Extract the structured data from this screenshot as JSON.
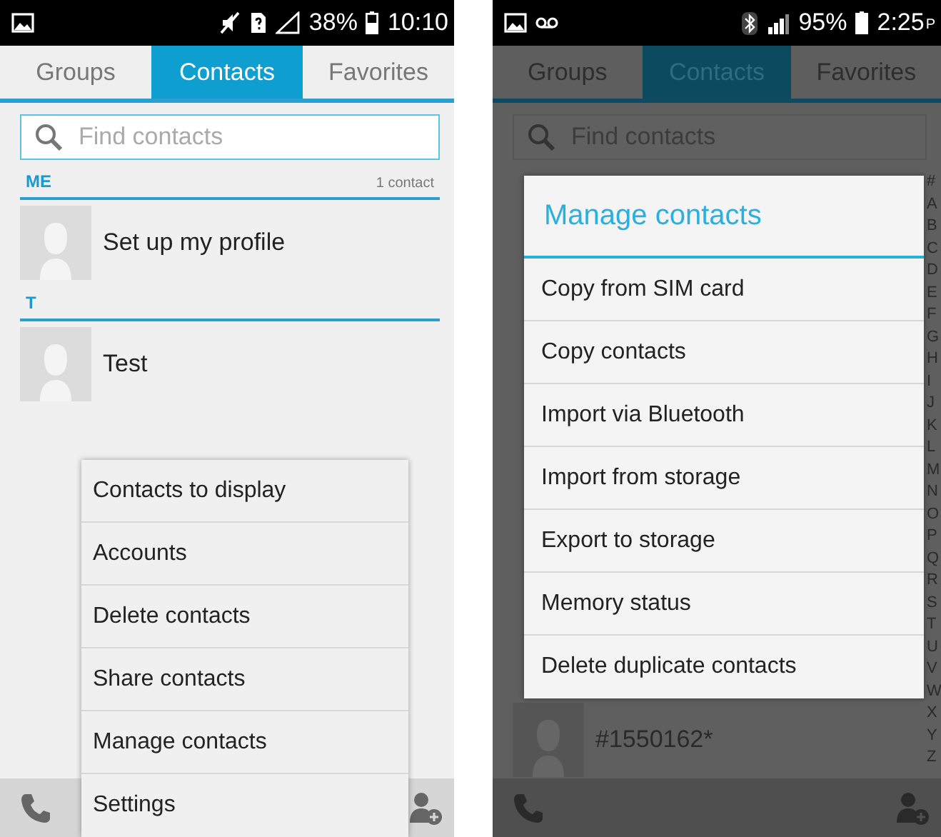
{
  "screens": [
    {
      "dimmed": false,
      "status_bar": {
        "vibrate_muted": true,
        "sim_missing": true,
        "no_signal": true,
        "battery": "38%",
        "time": "10:10"
      },
      "tabs": [
        {
          "label": "Groups",
          "selected": false
        },
        {
          "label": "Contacts",
          "selected": true
        },
        {
          "label": "Favorites",
          "selected": false
        }
      ],
      "search": {
        "placeholder": "Find contacts"
      },
      "sections": [
        {
          "header": "ME",
          "count": "1 contact",
          "contacts": [
            {
              "name": "Set up my profile"
            }
          ]
        },
        {
          "header": "T",
          "contacts": [
            {
              "name": "Test"
            }
          ]
        }
      ],
      "menu": {
        "items": [
          "Contacts to display",
          "Accounts",
          "Delete contacts",
          "Share contacts",
          "Manage contacts",
          "Settings"
        ]
      }
    },
    {
      "dimmed": true,
      "status_bar": {
        "voicemail": true,
        "bluetooth": true,
        "no_signal": false,
        "battery": "95%",
        "time": "2:25",
        "am_pm": "P"
      },
      "tabs": [
        {
          "label": "Groups",
          "selected": false
        },
        {
          "label": "Contacts",
          "selected": true
        },
        {
          "label": "Favorites",
          "selected": false
        }
      ],
      "search": {
        "placeholder": "Find contacts"
      },
      "index": [
        "#",
        "A",
        "B",
        "C",
        "D",
        "E",
        "F",
        "G",
        "H",
        "I",
        "J",
        "K",
        "L",
        "M",
        "N",
        "O",
        "P",
        "Q",
        "R",
        "S",
        "T",
        "U",
        "V",
        "W",
        "X",
        "Y",
        "Z"
      ],
      "bottom_contacts": [
        {
          "name": "#1550162*"
        }
      ],
      "dialog": {
        "title": "Manage contacts",
        "items": [
          "Copy from SIM card",
          "Copy contacts",
          "Import via Bluetooth",
          "Import from storage",
          "Export to storage",
          "Memory status",
          "Delete duplicate contacts"
        ]
      }
    }
  ]
}
